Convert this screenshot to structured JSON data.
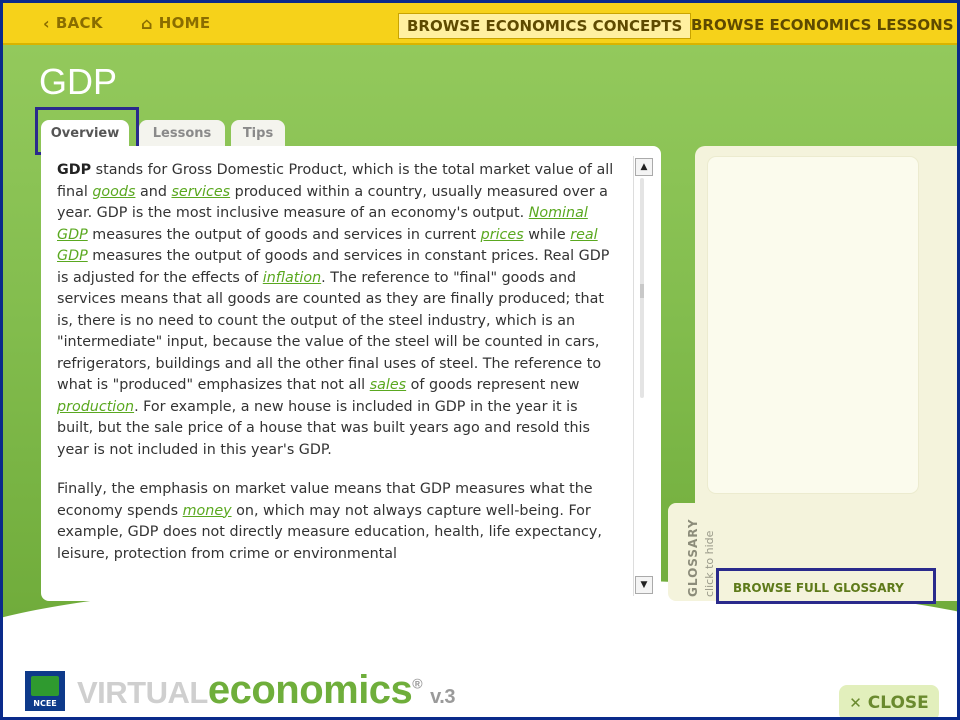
{
  "nav": {
    "back": "BACK",
    "home": "HOME",
    "browse_concepts": "BROWSE ECONOMICS CONCEPTS",
    "browse_lessons": "BROWSE ECONOMICS LESSONS"
  },
  "page": {
    "title": "GDP"
  },
  "tabs": [
    {
      "label": "Overview",
      "selected": true
    },
    {
      "label": "Lessons"
    },
    {
      "label": "Tips"
    }
  ],
  "content": {
    "p1": [
      "GDP",
      " stands for Gross Domestic Product, which is the total market value of all final ",
      "goods",
      " and ",
      "services",
      " produced within a country, usually measured over a year. GDP is the most inclusive measure of an economy's output. ",
      "Nominal GDP",
      " measures the output of goods and services in current ",
      "prices",
      " while ",
      "real GDP",
      " measures the output of goods and services in constant prices.  Real GDP is adjusted for the effects of ",
      "inflation",
      ".  The reference to \"final\" goods and services means that all goods are counted as they are finally produced; that is, there is no need to count the output of the steel industry, which is an \"intermediate\" input, because the value of the steel will be counted in cars, refrigerators, buildings and all the other final uses of steel. The reference to what is \"produced\" emphasizes that not all ",
      "sales",
      " of goods represent new ",
      "production",
      ". For example, a new house is included in GDP in the year it is built, but the sale price of a house that was built years ago and resold this year is not included in this year's GDP."
    ],
    "p2": [
      "Finally, the emphasis on market value means that GDP measures what the economy spends ",
      "money",
      " on, which may not always capture well-being. For example, GDP does not directly measure education, health, life expectancy, leisure, protection from crime or environmental"
    ]
  },
  "glossary": {
    "label": "GLOSSARY",
    "hide": "click to hide",
    "browse": "BROWSE FULL GLOSSARY"
  },
  "footer": {
    "logo": "NCEE",
    "brand_a": "VIRTUAL",
    "brand_b": "economics",
    "brand_mark": "®",
    "version": "v.3",
    "close": "CLOSE"
  },
  "icons": {
    "back": "chevron-left-icon",
    "home": "home-icon",
    "close": "close-icon"
  },
  "colors": {
    "topbar": "#f6d21a",
    "green": "#83bd4e",
    "link": "#5aa820",
    "highlight_box": "#2a2a8c"
  }
}
